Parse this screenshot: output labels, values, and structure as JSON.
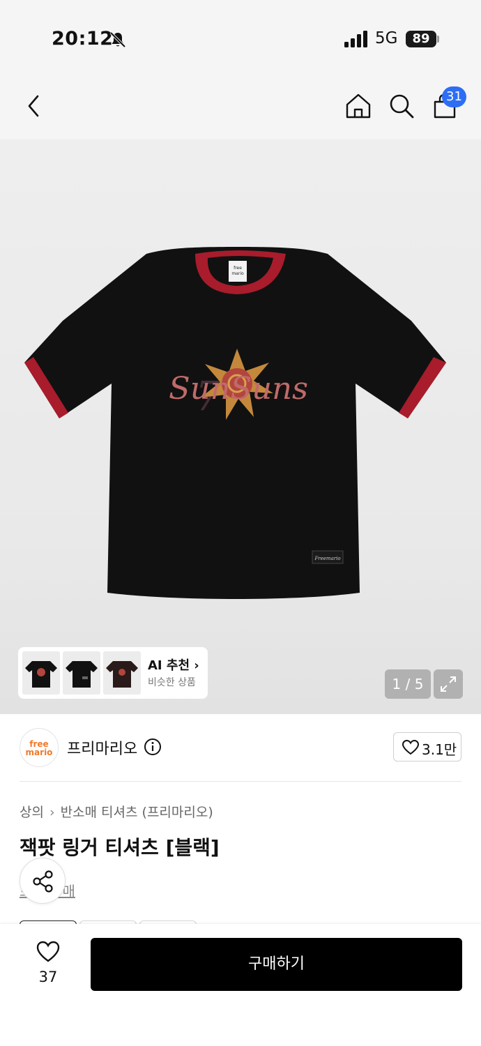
{
  "status_bar": {
    "time": "20:12",
    "network": "5G",
    "battery": "89"
  },
  "header": {
    "cart_count": "31",
    "icons": [
      "back-icon",
      "home-icon",
      "search-icon",
      "cart-icon"
    ]
  },
  "gallery": {
    "ai_title": "AI 추천",
    "ai_subtitle": "비슷한 상품",
    "page_counter": "1 / 5",
    "current_page": 1,
    "total_pages": 5,
    "print_text": "SunSuns"
  },
  "brand": {
    "name": "프리마리오",
    "logo_line1": "free",
    "logo_line2": "mario",
    "like_count": "3.1만"
  },
  "product": {
    "breadcrumb": [
      "상의",
      "반소매 티셔츠 (프리마리오)"
    ],
    "title": "잭팟 링거 티셔츠 [블랙]",
    "sub_link": "브랜드 매"
  },
  "bottom_bar": {
    "wish_count": "37",
    "buy_label": "구매하기"
  },
  "colors": {
    "accent_badge": "#2d6ef5",
    "buy_button": "#000000",
    "ringer_red": "#a81c2c",
    "brand_orange": "#f07a2a"
  }
}
